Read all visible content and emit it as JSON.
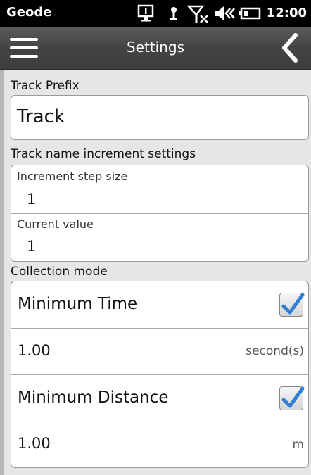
{
  "status_bar": {
    "app_name": "Geode",
    "time": "12:00",
    "icons": [
      "sync-icon",
      "gps-icon",
      "no-signal-icon",
      "volume-muted-icon",
      "battery-icon"
    ]
  },
  "title_bar": {
    "title": "Settings",
    "menu_icon": "hamburger-menu-icon",
    "back_icon": "chevron-left-icon"
  },
  "track_prefix": {
    "label": "Track Prefix",
    "value": "Track"
  },
  "increment": {
    "label": "Track name increment settings",
    "step_label": "Increment step size",
    "step_value": "1",
    "current_label": "Current value",
    "current_value": "1"
  },
  "collection_mode": {
    "label": "Collection mode",
    "rows": [
      {
        "label": "Minimum Time",
        "checked": true,
        "value": "1.00",
        "unit": "second(s)"
      },
      {
        "label": "Minimum Distance",
        "checked": true,
        "value": "1.00",
        "unit": "m"
      }
    ]
  },
  "colors": {
    "accent_check": "#2f7fd6",
    "title_bar": "#454545",
    "status_bar": "#000000",
    "background": "#e6e6e6"
  }
}
